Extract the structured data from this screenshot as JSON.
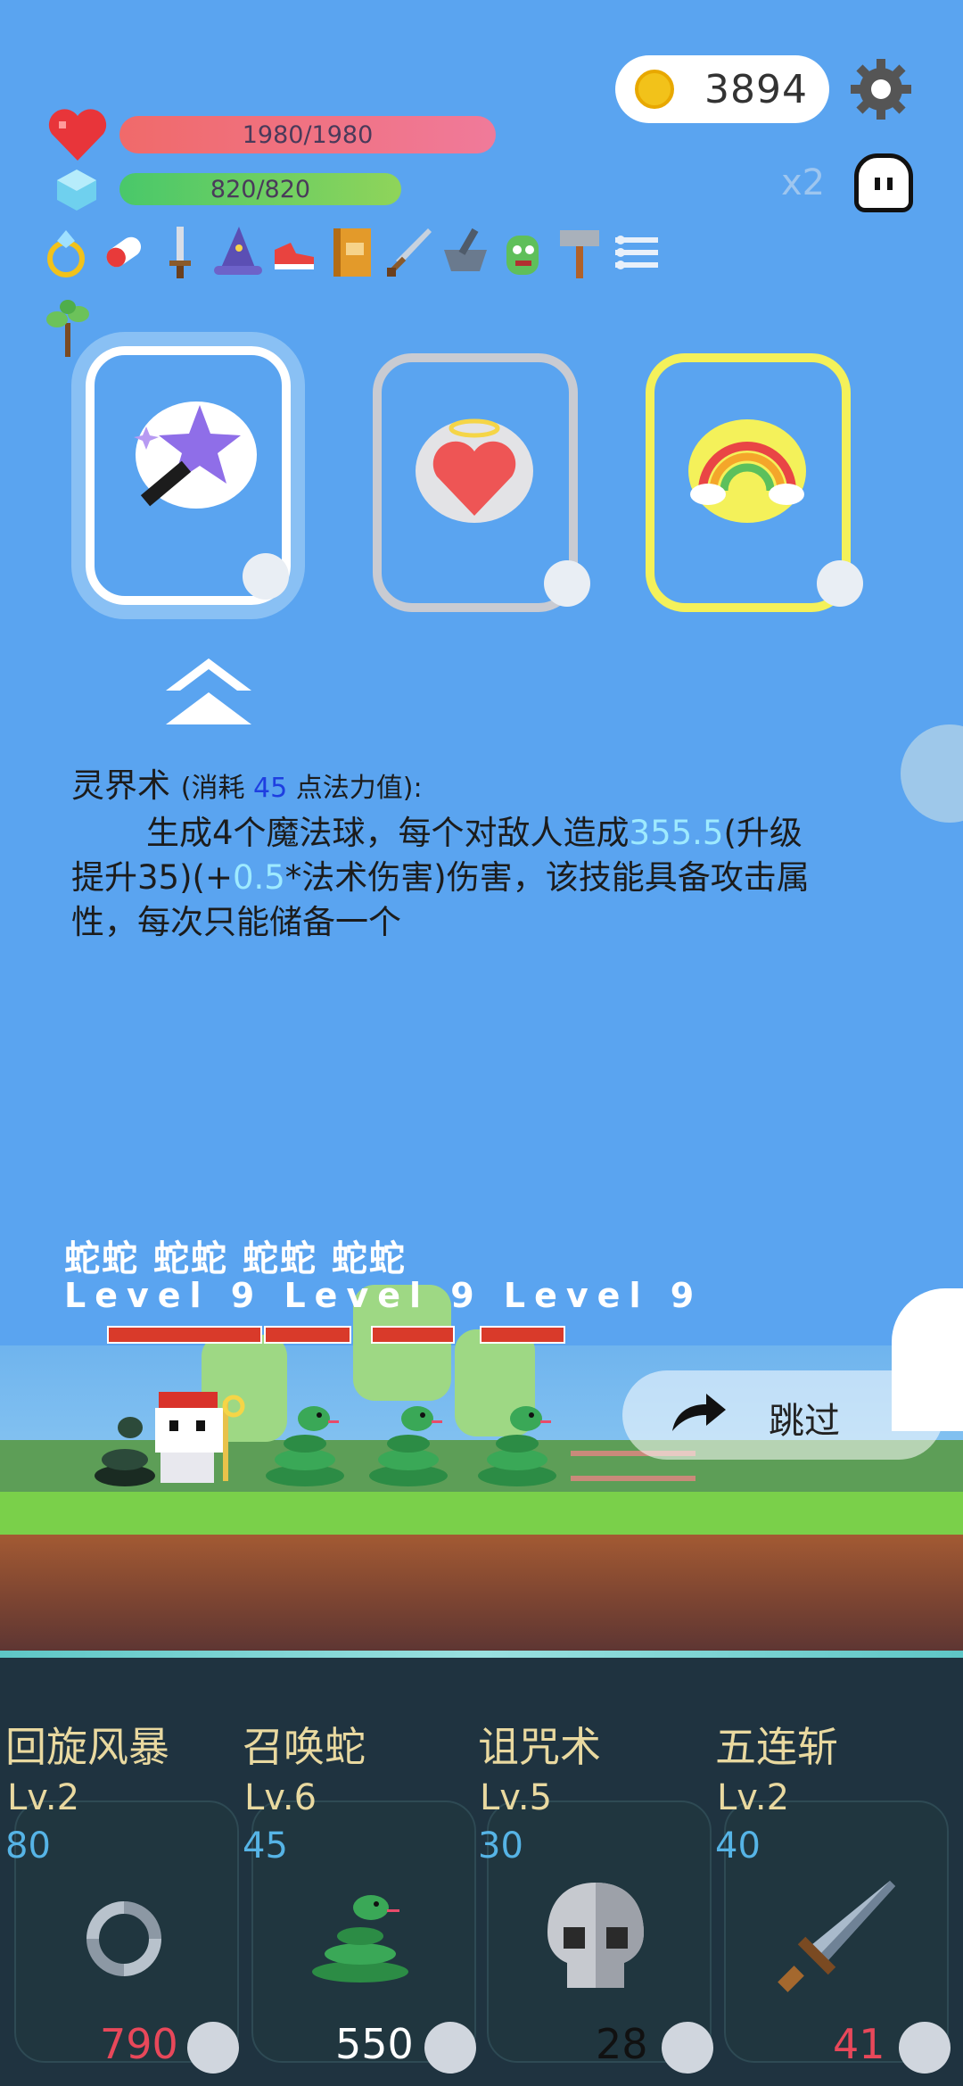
{
  "hud": {
    "coins": "3894",
    "hp_text": "1980/1980",
    "mp_text": "820/820",
    "speed_label": "x2"
  },
  "inventory_icons": [
    "ring-icon",
    "capsule-icon",
    "dagger-icon",
    "wizard-hat-icon",
    "sneaker-icon",
    "book-icon",
    "sword-icon",
    "mortar-icon",
    "monster-icon",
    "hammer-icon",
    "triple-line-icon",
    "sapling-icon"
  ],
  "skill_choice": {
    "cards": [
      {
        "name": "magic-wand-card",
        "selected": true,
        "frame_color": "#ffffff"
      },
      {
        "name": "holy-heart-card",
        "selected": false,
        "frame_color": "#c9cbd2"
      },
      {
        "name": "rainbow-card",
        "selected": false,
        "frame_color": "#f4f15a"
      }
    ],
    "description": {
      "skill_name": "灵界术",
      "cost_prefix": "(消耗 ",
      "cost_value": "45",
      "cost_suffix": " 点法力值):",
      "line1_prefix": "生成4个魔法球，每个对敌人造成",
      "damage_value": "355.5",
      "line1_suffix": "(升级",
      "line2_prefix": "提升35)(+",
      "ratio_value": "0.5",
      "line2_suffix": "*法术伤害)伤害，该技能具备攻击属",
      "line3": "性，每次只能储备一个"
    }
  },
  "battle": {
    "enemy_names": "蛇蛇 蛇蛇 蛇蛇  蛇蛇",
    "enemy_levels": "Level 9  Level 9  Level 9",
    "skip_label": "跳过"
  },
  "skills": [
    {
      "name": "回旋风暴",
      "level": "Lv.2",
      "cost": "80",
      "count": "790",
      "count_color": "#e8485a",
      "icon": "cyclone-icon"
    },
    {
      "name": "召唤蛇",
      "level": "Lv.6",
      "cost": "45",
      "count": "550",
      "count_color": "#ffffff",
      "icon": "snake-icon"
    },
    {
      "name": "诅咒术",
      "level": "Lv.5",
      "cost": "30",
      "count": "28",
      "count_color": "#111111",
      "icon": "skull-icon"
    },
    {
      "name": "五连斩",
      "level": "Lv.2",
      "cost": "40",
      "count": "41",
      "count_color": "#e8485a",
      "icon": "sword-icon"
    }
  ]
}
